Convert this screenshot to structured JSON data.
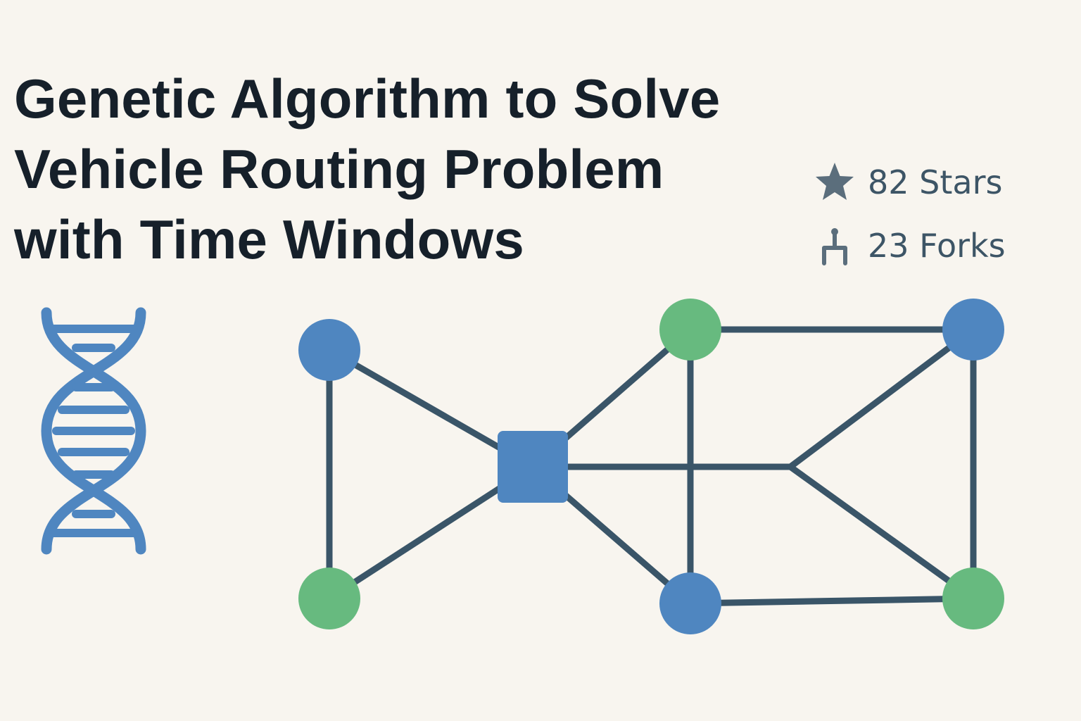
{
  "title_lines": [
    "Genetic Algorithm to Solve",
    "Vehicle Routing Problem",
    "with Time Windows"
  ],
  "stats": {
    "stars": "82 Stars",
    "forks": "23 Forks"
  },
  "icons": {
    "stars": "star-icon",
    "forks": "fork-icon",
    "decor": "dna-icon"
  },
  "colors": {
    "background": "#f8f5ef",
    "title": "#16202a",
    "stat_text": "#3d5566",
    "dna": "#4f86c0",
    "edge": "#3a5568",
    "node_blue": "#4f86c0",
    "node_green": "#67ba7f",
    "depot": "#4f86c0"
  },
  "graph": {
    "depot": {
      "id": "depot",
      "shape": "square"
    },
    "nodes": [
      {
        "id": "n1",
        "color": "blue"
      },
      {
        "id": "n2",
        "color": "green"
      },
      {
        "id": "n3",
        "color": "green"
      },
      {
        "id": "n4",
        "color": "blue"
      },
      {
        "id": "n5",
        "color": "blue"
      },
      {
        "id": "n6",
        "color": "green"
      }
    ],
    "junctions": [
      {
        "id": "j1"
      },
      {
        "id": "j2"
      }
    ],
    "edges": [
      [
        "n1",
        "depot"
      ],
      [
        "n1",
        "n2"
      ],
      [
        "n2",
        "depot"
      ],
      [
        "depot",
        "n3"
      ],
      [
        "depot",
        "n5"
      ],
      [
        "depot",
        "j1"
      ],
      [
        "n3",
        "n4"
      ],
      [
        "n3",
        "n5"
      ],
      [
        "n4",
        "j2"
      ],
      [
        "n4",
        "n6"
      ],
      [
        "n5",
        "n6"
      ],
      [
        "j1",
        "j2"
      ],
      [
        "j2",
        "n6"
      ]
    ]
  }
}
